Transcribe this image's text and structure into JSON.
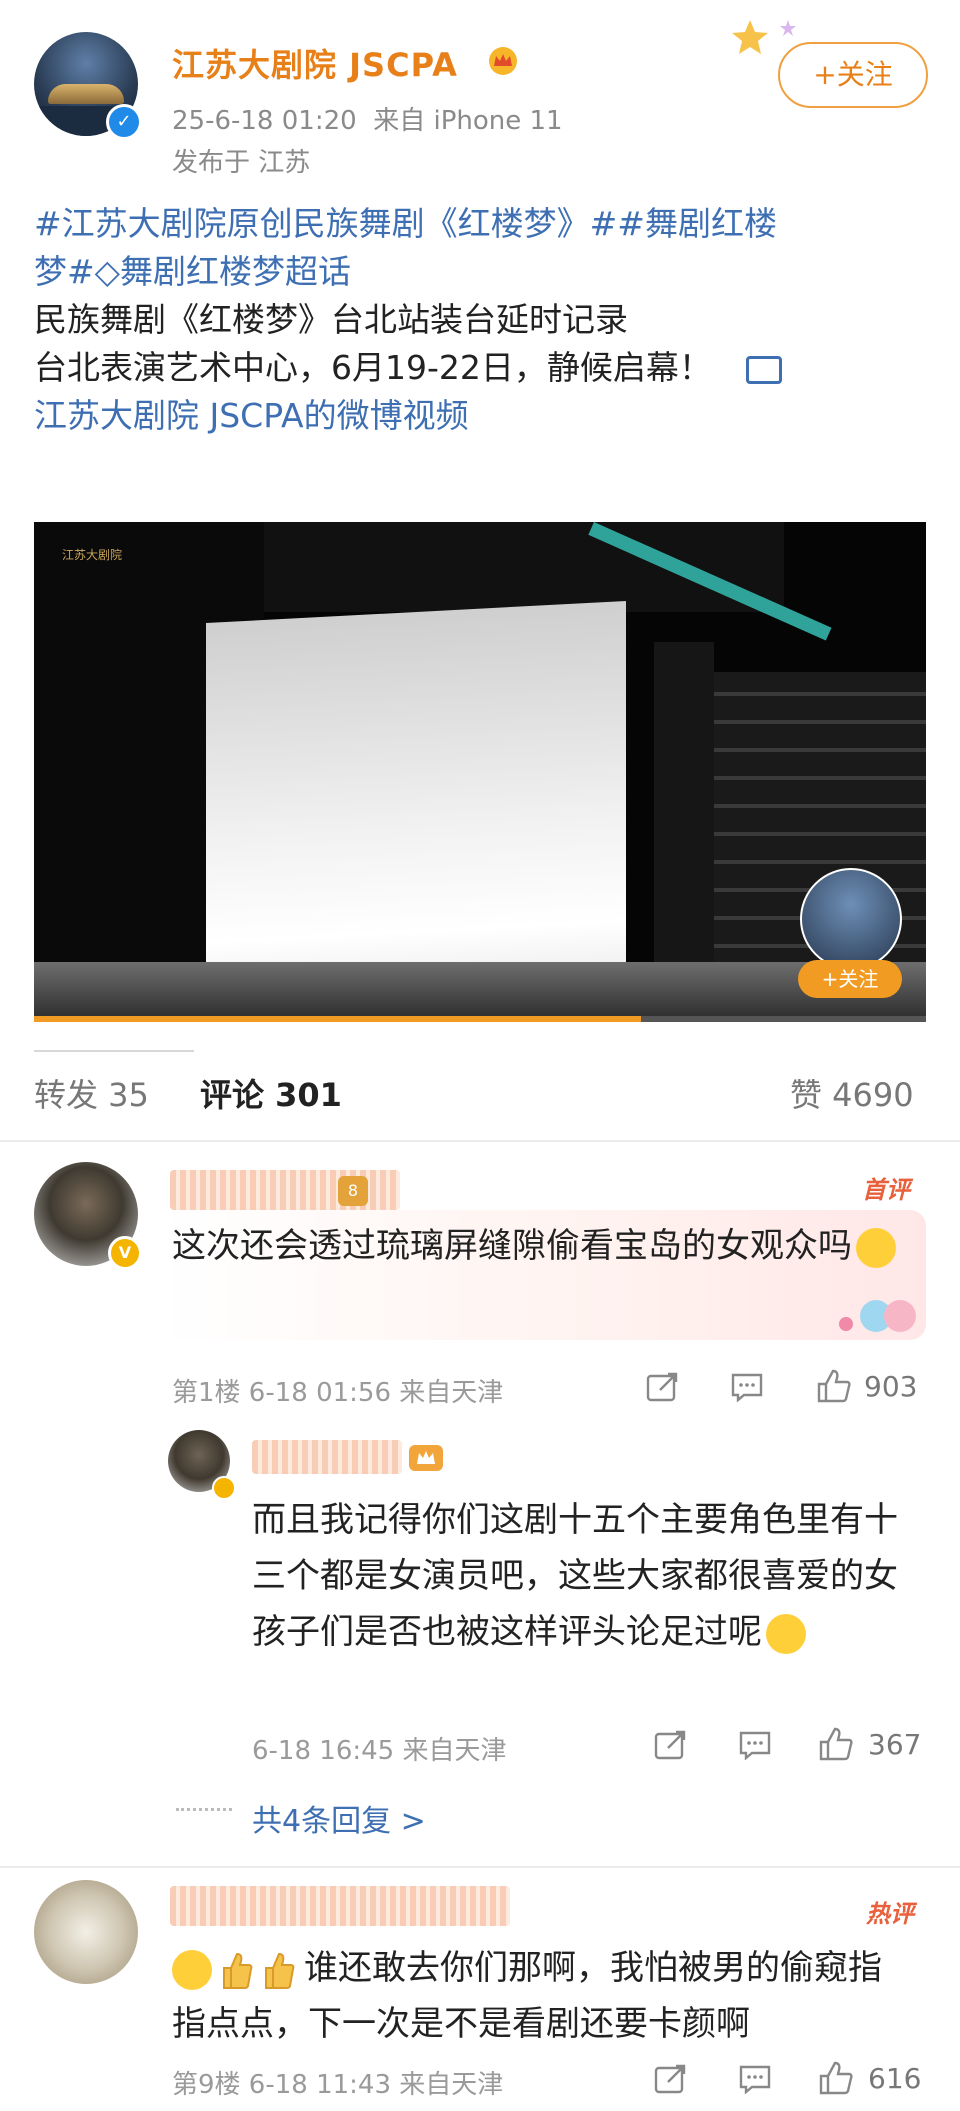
{
  "post": {
    "account_name": "江苏大剧院 JSCPA",
    "time": "25-6-18 01:20",
    "source": "来自 iPhone 11",
    "location": "发布于 江苏",
    "follow_label": "+关注",
    "line1": "#江苏大剧院原创民族舞剧《红楼梦》##舞剧红楼",
    "line2_tag_a": "梦#",
    "line2_tag_b": "舞剧红楼梦超话",
    "line3": "民族舞剧《红楼梦》台北站装台延时记录",
    "line4": "台北表演艺术中心，6月19-22日，静候启幕！",
    "video_link": "江苏大剧院 JSCPA的微博视频",
    "video": {
      "logo_text": "江苏大剧院",
      "follow_label": "+关注",
      "progress": 0.68,
      "accent": "#f29b22"
    }
  },
  "stats": {
    "repost": "转发 35",
    "comments": "评论 301",
    "likes": "赞 4690"
  },
  "comment1": {
    "badge": "首评",
    "level": "8",
    "text": "这次还会透过琉璃屏缝隙偷看宝岛的女观众吗",
    "meta": "第1楼  6-18 01:56  来自天津",
    "like_count": "903"
  },
  "reply1": {
    "text": "而且我记得你们这剧十五个主要角色里有十三个都是女演员吧，这些大家都很喜爱的女孩子们是否也被这样评头论足过呢",
    "meta": "6-18 16:45  来自天津",
    "like_count": "367",
    "more_replies": "共4条回复 >"
  },
  "comment2": {
    "badge": "热评",
    "text": "谁还敢去你们那啊，我怕被男的偷窥指指点点，下一次是不是看剧还要卡颜啊",
    "meta": "第9楼  6-18 11:43  来自天津",
    "like_count": "616"
  },
  "colors": {
    "brand_orange": "#e8801a",
    "link_blue": "#3e6fb3",
    "verified_blue": "#1f8ae8"
  }
}
